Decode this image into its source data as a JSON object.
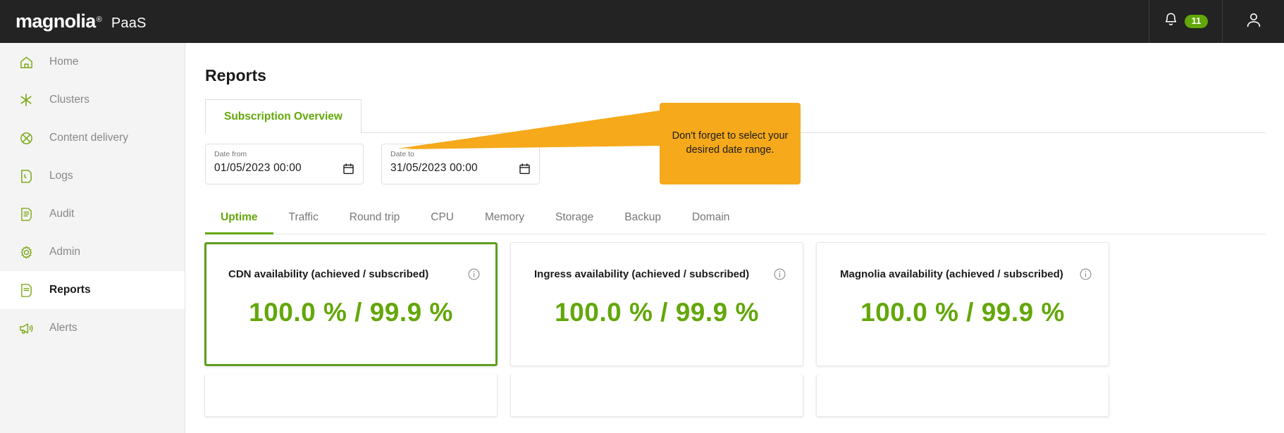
{
  "topbar": {
    "logo_text": "magnolia",
    "logo_reg": "®",
    "product": "PaaS",
    "notification_count": "11",
    "notification_icon": "bell-icon",
    "user_icon": "user-avatar-icon"
  },
  "sidebar": {
    "items": [
      {
        "label": "Home",
        "icon": "home-icon",
        "active": false
      },
      {
        "label": "Clusters",
        "icon": "clusters-asterisk-icon",
        "active": false
      },
      {
        "label": "Content delivery",
        "icon": "content-delivery-globe-icon",
        "active": false
      },
      {
        "label": "Logs",
        "icon": "logs-document-icon",
        "active": false
      },
      {
        "label": "Audit",
        "icon": "audit-document-icon",
        "active": false
      },
      {
        "label": "Admin",
        "icon": "gear-icon",
        "active": false
      },
      {
        "label": "Reports",
        "icon": "reports-document-icon",
        "active": true
      },
      {
        "label": "Alerts",
        "icon": "megaphone-icon",
        "active": false
      }
    ]
  },
  "main": {
    "page_title": "Reports",
    "top_tabs": [
      {
        "label": "Subscription Overview",
        "active": true
      }
    ],
    "date_from": {
      "label": "Date from",
      "value": "01/05/2023  00:00",
      "icon": "calendar-icon"
    },
    "date_to": {
      "label": "Date to",
      "value": "31/05/2023  00:00",
      "icon": "calendar-icon"
    },
    "callout": {
      "text": "Don't forget to select your\ndesired date range.",
      "color": "#F5A91B"
    },
    "metric_tabs": [
      {
        "label": "Uptime",
        "active": true
      },
      {
        "label": "Traffic",
        "active": false
      },
      {
        "label": "Round trip",
        "active": false
      },
      {
        "label": "CPU",
        "active": false
      },
      {
        "label": "Memory",
        "active": false
      },
      {
        "label": "Storage",
        "active": false
      },
      {
        "label": "Backup",
        "active": false
      },
      {
        "label": "Domain",
        "active": false
      }
    ],
    "cards": [
      {
        "title": "CDN availability (achieved / subscribed)",
        "value": "100.0 % / 99.9 %",
        "info_icon": "info-circle-icon",
        "selected": true
      },
      {
        "title": "Ingress availability (achieved / subscribed)",
        "value": "100.0 % / 99.9 %",
        "info_icon": "info-circle-icon",
        "selected": false
      },
      {
        "title": "Magnolia availability (achieved / subscribed)",
        "value": "100.0 % / 99.9 %",
        "info_icon": "info-circle-icon",
        "selected": false
      }
    ]
  },
  "colors": {
    "brand_green": "#63A70A",
    "selection_green": "#5E9E1E",
    "callout_orange": "#F5A91B",
    "topbar_dark": "#232323",
    "sidebar_grey": "#f4f4f4"
  }
}
